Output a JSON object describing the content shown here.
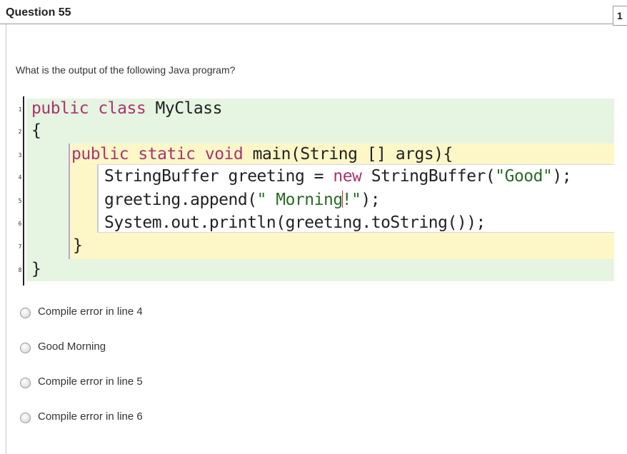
{
  "question": {
    "title": "Question 55",
    "points": "1",
    "prompt": "What is the output of the following Java program?"
  },
  "code": {
    "line_numbers": [
      "1",
      "2",
      "3",
      "4",
      "5",
      "6",
      "7",
      "8"
    ],
    "lines": [
      [
        {
          "t": "public class ",
          "c": "kw"
        },
        {
          "t": "MyClass",
          "c": ""
        }
      ],
      [
        {
          "t": "{",
          "c": ""
        }
      ],
      [
        {
          "t": "public static void ",
          "c": "kw"
        },
        {
          "t": "main(String [] args){",
          "c": ""
        }
      ],
      [
        {
          "t": "StringBuffer greeting = ",
          "c": ""
        },
        {
          "t": "new ",
          "c": "kw"
        },
        {
          "t": "StringBuffer(",
          "c": ""
        },
        {
          "t": "\"Good\"",
          "c": "str"
        },
        {
          "t": ");",
          "c": ""
        }
      ],
      [
        {
          "t": "greeting.append(",
          "c": ""
        },
        {
          "t": "\" Morning",
          "c": "str"
        },
        {
          "t": "|",
          "c": "cursor"
        },
        {
          "t": "!\"",
          "c": "str"
        },
        {
          "t": ");",
          "c": ""
        }
      ],
      [
        {
          "t": "System.out.println(greeting.toString());",
          "c": ""
        }
      ],
      [
        {
          "t": "}",
          "c": ""
        }
      ],
      [
        {
          "t": "}",
          "c": ""
        }
      ]
    ]
  },
  "options": [
    {
      "label": "Compile error in line 4"
    },
    {
      "label": "Good Morning"
    },
    {
      "label": "Compile error in line 5"
    },
    {
      "label": "Compile error in line 6"
    }
  ]
}
